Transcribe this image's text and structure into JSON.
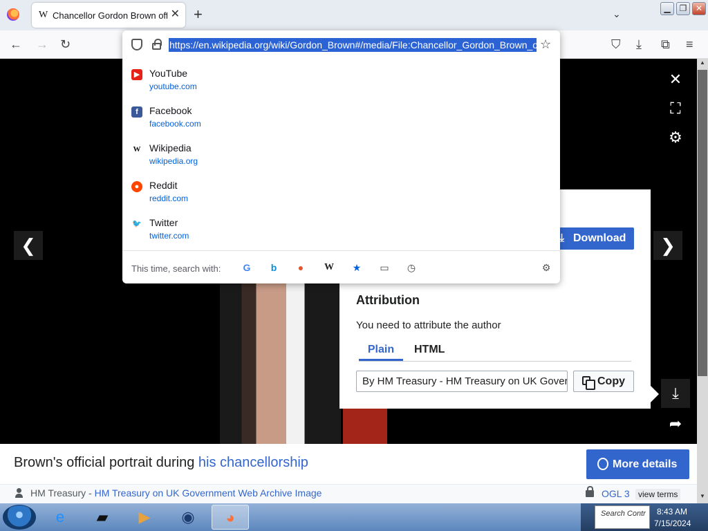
{
  "browser": {
    "tab_title": "Chancellor Gordon Brown offic",
    "tab_favicon": "W",
    "url": "https://en.wikipedia.org/wiki/Gordon_Brown#/media/File:Chancellor_Gordon_Brown_offi",
    "new_tab_glyph": "+",
    "tab_close_glyph": "✕",
    "tab_list_glyph": "⌄",
    "window_buttons": [
      "▁",
      "❐",
      "✕"
    ],
    "nav_icons": {
      "back": "←",
      "forward": "→",
      "reload": "↻",
      "star": "☆",
      "pocket": "⛉",
      "downloads": "⤓",
      "extensions": "⧉",
      "menu": "≡"
    }
  },
  "suggestions": [
    {
      "title": "YouTube",
      "url": "youtube.com",
      "icon": "youtube-icon",
      "icon_glyph": "▶",
      "color": "#e62117"
    },
    {
      "title": "Facebook",
      "url": "facebook.com",
      "icon": "facebook-icon",
      "icon_glyph": "f",
      "color": "#3b5998"
    },
    {
      "title": "Wikipedia",
      "url": "wikipedia.org",
      "icon": "wikipedia-icon",
      "icon_glyph": "W",
      "color": "#ffffff"
    },
    {
      "title": "Reddit",
      "url": "reddit.com",
      "icon": "reddit-icon",
      "icon_glyph": "●",
      "color": "#ff4500"
    },
    {
      "title": "Twitter",
      "url": "twitter.com",
      "icon": "twitter-icon",
      "icon_glyph": "🐦",
      "color": "#1da1f2"
    }
  ],
  "search_row": {
    "label": "This time, search with:",
    "engines": [
      {
        "name": "google-icon",
        "glyph": "G",
        "color": "#4285f4"
      },
      {
        "name": "bing-icon",
        "glyph": "b",
        "color": "#0c8cd8"
      },
      {
        "name": "duckduckgo-icon",
        "glyph": "●",
        "color": "#de5833"
      },
      {
        "name": "wikipedia-icon",
        "glyph": "W",
        "color": "#222222"
      },
      {
        "name": "bookmarks-icon",
        "glyph": "★",
        "color": "#0060df"
      },
      {
        "name": "tabs-icon",
        "glyph": "▭",
        "color": "#444444"
      },
      {
        "name": "history-icon",
        "glyph": "◷",
        "color": "#444444"
      }
    ],
    "settings_glyph": "⚙"
  },
  "viewer": {
    "close_glyph": "✕",
    "fullscreen_glyph": "⛶",
    "settings_glyph": "⚙",
    "prev_glyph": "❮",
    "next_glyph": "❯",
    "download_side_glyph": "⤓",
    "share_glyph": "➦"
  },
  "card": {
    "download_label": "Download",
    "download_glyph": "⤓",
    "attribution_heading": "Attribution",
    "attribution_sub": "You need to attribute the author",
    "tabs": [
      "Plain",
      "HTML"
    ],
    "attribution_value": "By HM Treasury - HM Treasury on UK Government Web Archive",
    "copy_label": "Copy"
  },
  "caption": {
    "text": "Brown's official portrait during ",
    "link": "his chancellorship",
    "more_details": "More details",
    "author": "HM Treasury",
    "separator": " - ",
    "source_link": "HM Treasury on UK Government Web Archive Image",
    "license": "OGL 3",
    "view_terms": "view terms"
  },
  "taskbar": {
    "time": "8:43 AM",
    "date": "7/15/2024",
    "popup": "Search Contr",
    "apps": [
      {
        "name": "internet-explorer-icon",
        "glyph": "e",
        "color": "#1e90ff"
      },
      {
        "name": "media-center-icon",
        "glyph": "▰",
        "color": "#111111"
      },
      {
        "name": "media-player-icon",
        "glyph": "▶",
        "color": "#e6a23c"
      },
      {
        "name": "globe-app-icon",
        "glyph": "◉",
        "color": "#1b3b6f"
      },
      {
        "name": "firefox-icon",
        "glyph": "◕",
        "color": "#ff7139"
      }
    ]
  }
}
